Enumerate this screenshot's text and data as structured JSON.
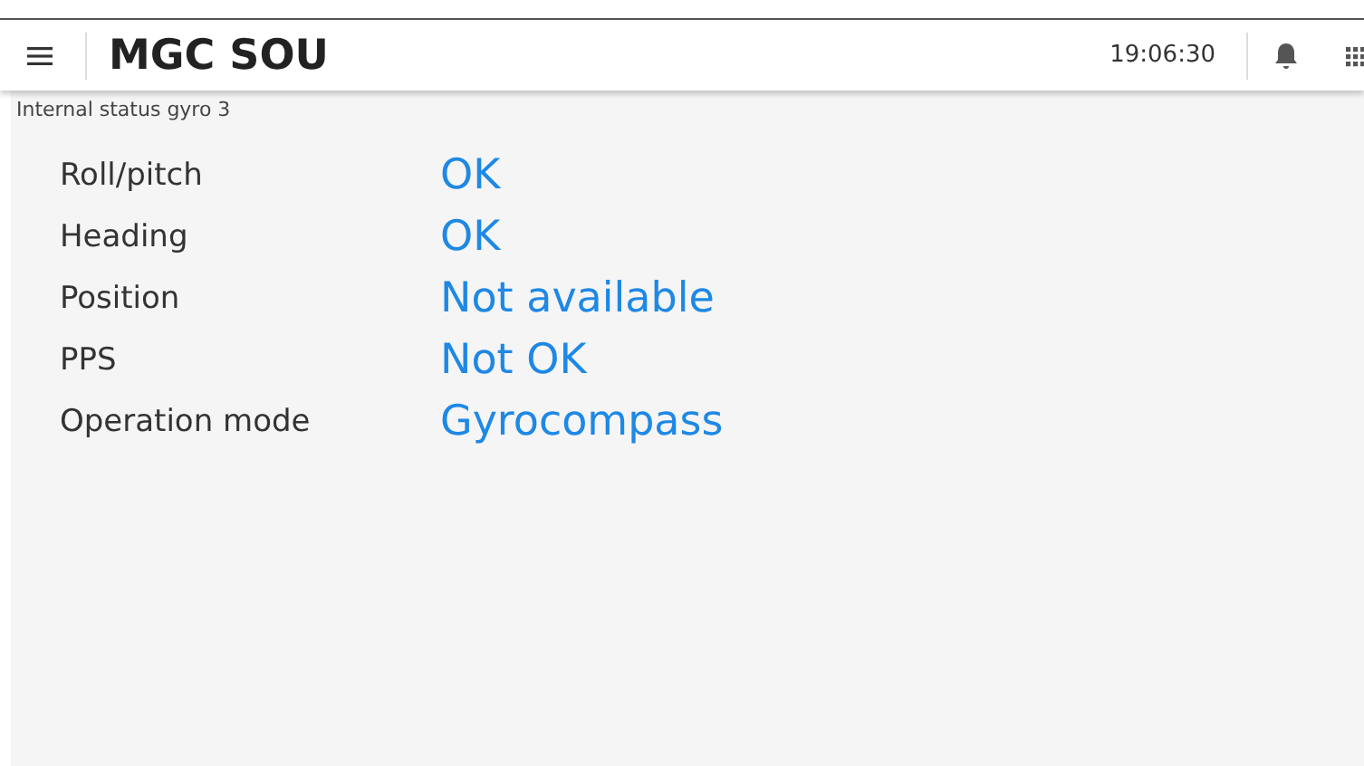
{
  "header": {
    "title": "MGC SOU",
    "time": "19:06:30"
  },
  "subtitle": "Internal status gyro 3",
  "status_rows": [
    {
      "label": "Roll/pitch",
      "value": "OK"
    },
    {
      "label": "Heading",
      "value": "OK"
    },
    {
      "label": "Position",
      "value": "Not available"
    },
    {
      "label": "PPS",
      "value": "Not OK"
    },
    {
      "label": "Operation mode",
      "value": "Gyrocompass"
    }
  ]
}
